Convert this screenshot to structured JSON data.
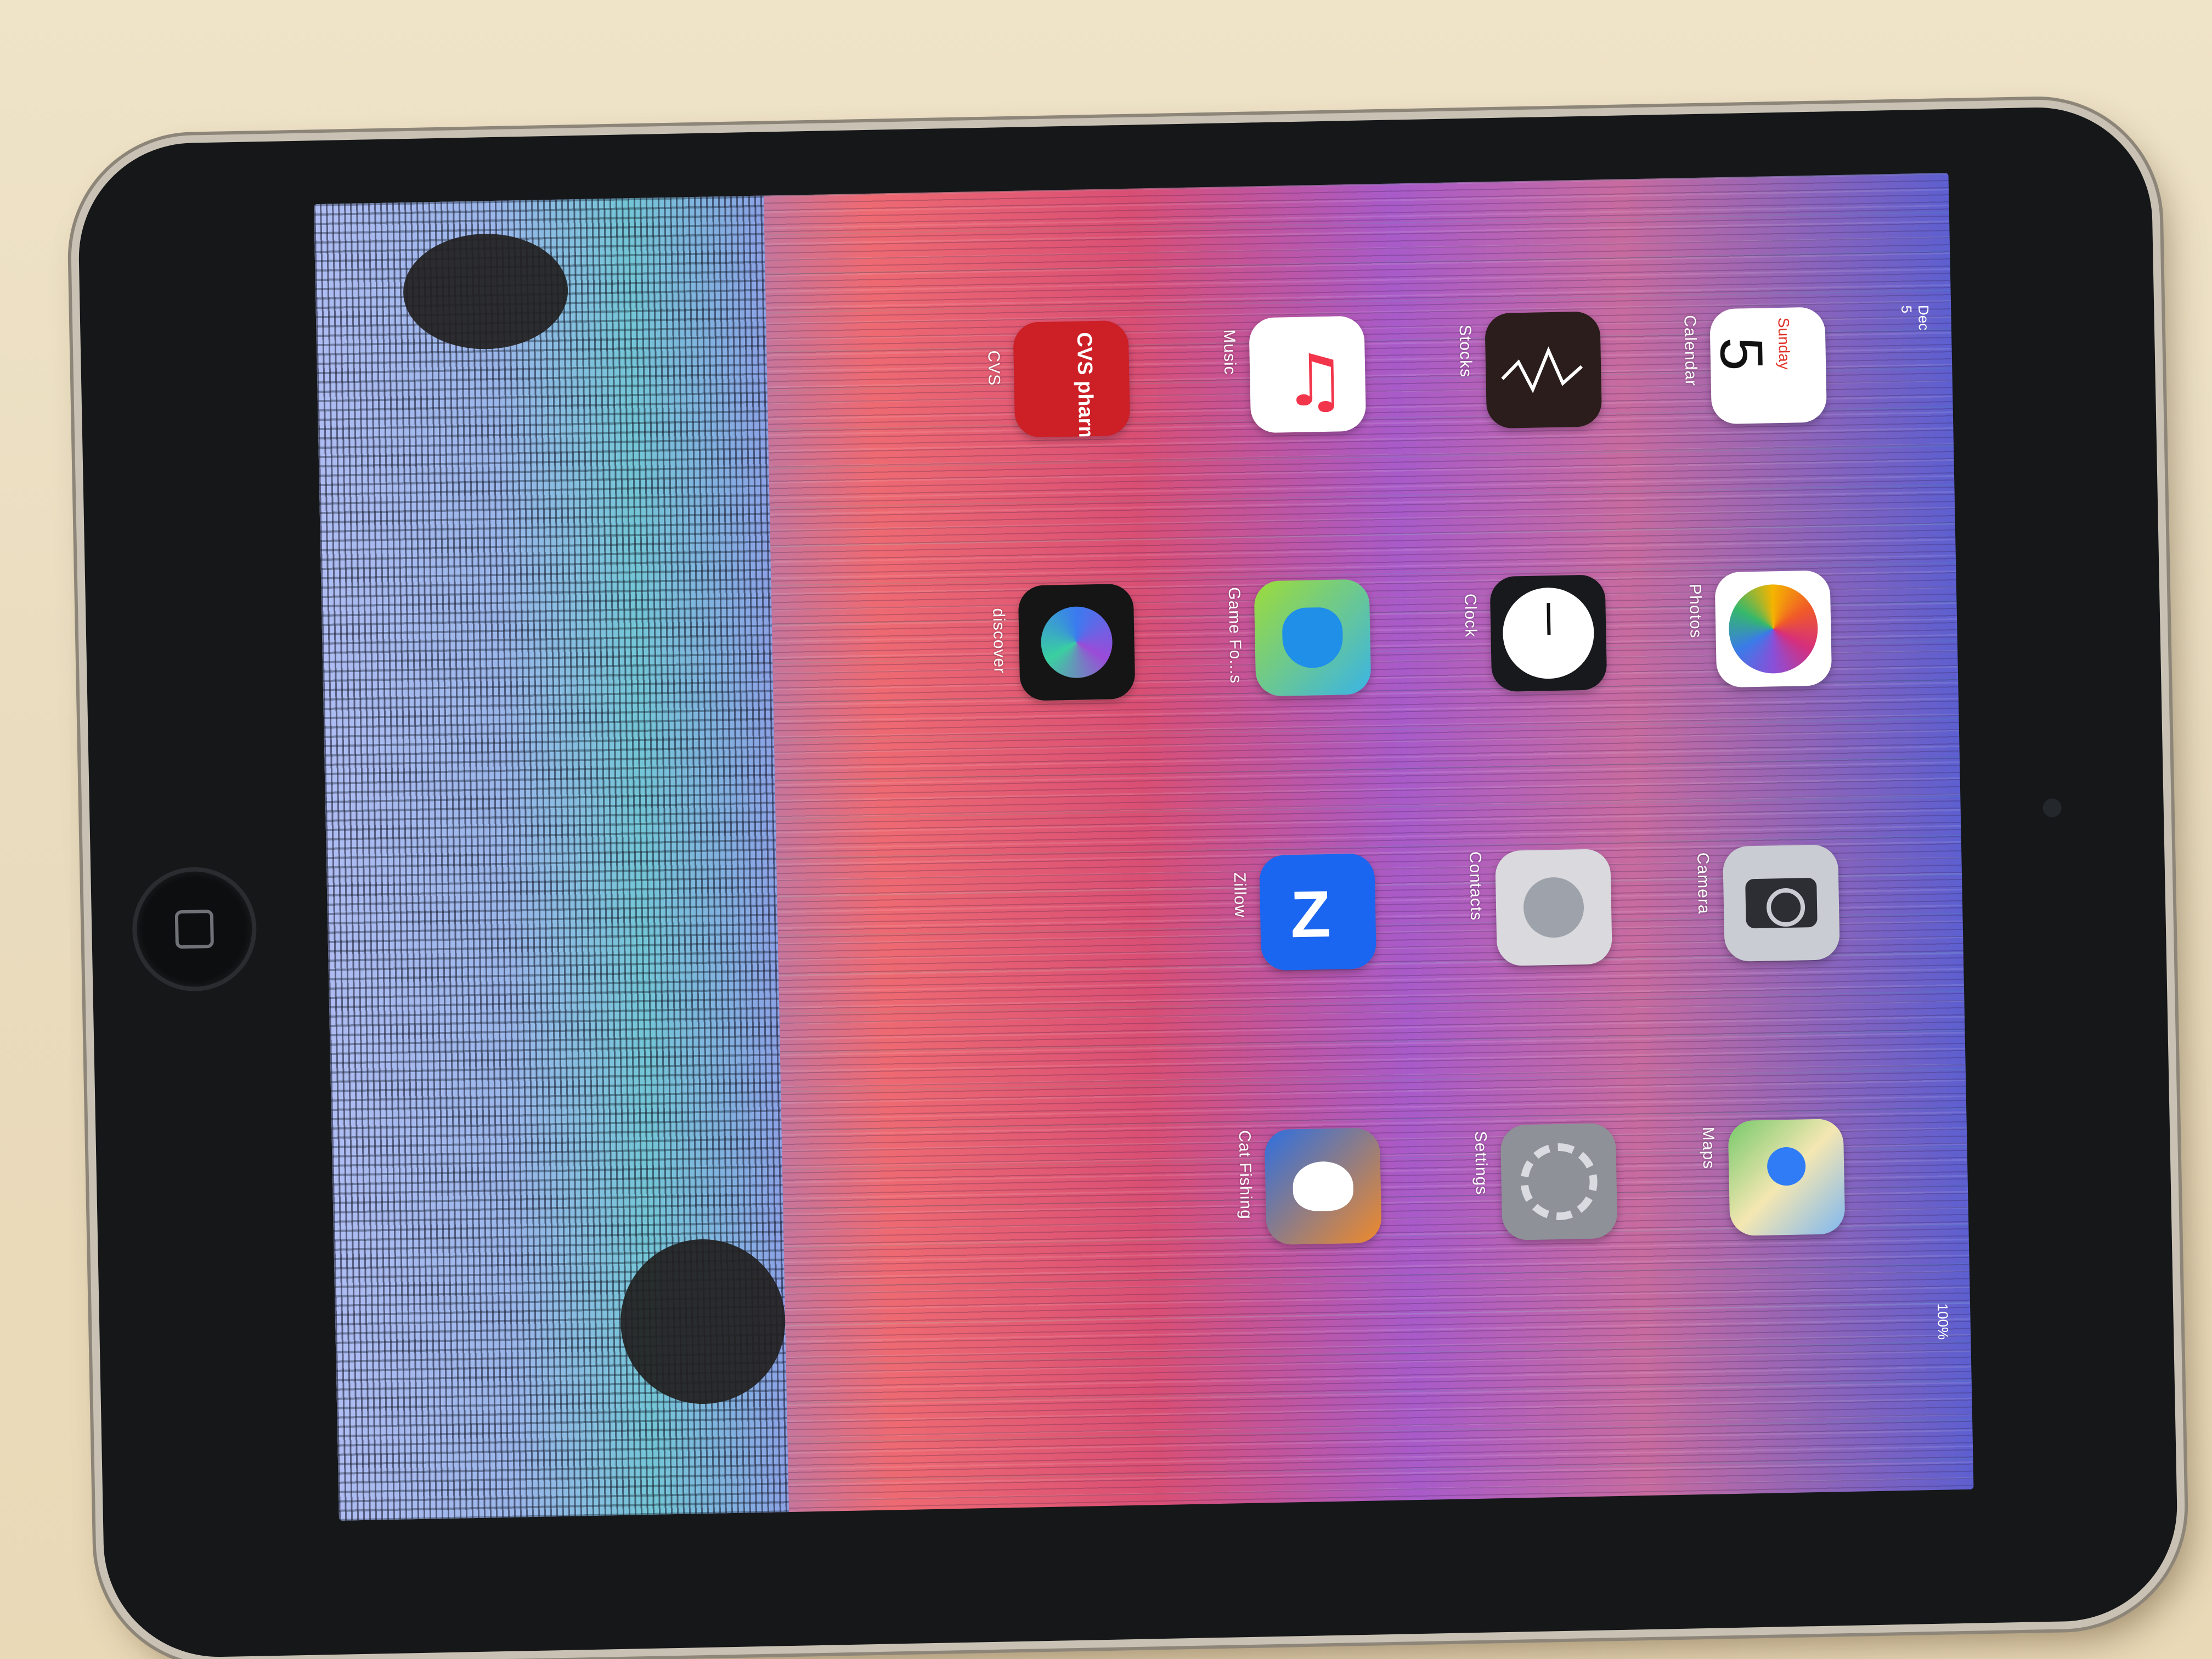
{
  "statusbar": {
    "date": "Dec 5",
    "battery": "100%"
  },
  "calendar_widget": {
    "weekday": "Sunday",
    "day": "5"
  },
  "apps": [
    {
      "label": "Calendar",
      "icon": "calendar-icon"
    },
    {
      "label": "Stocks",
      "icon": "stocks-icon"
    },
    {
      "label": "Music",
      "icon": "music-icon"
    },
    {
      "label": "CVS",
      "icon": "cvs-pharmacy-icon",
      "icon_text": "CVS pharmacy"
    },
    {
      "label": "Photos",
      "icon": "photos-icon"
    },
    {
      "label": "Clock",
      "icon": "clock-icon"
    },
    {
      "label": "Game Fo...s",
      "icon": "game-icon"
    },
    {
      "label": "discover",
      "icon": "discovery-icon"
    },
    {
      "label": "Camera",
      "icon": "camera-icon"
    },
    {
      "label": "Contacts",
      "icon": "contacts-icon"
    },
    {
      "label": "Zillow",
      "icon": "zillow-icon"
    },
    {
      "label": "Maps",
      "icon": "maps-icon"
    },
    {
      "label": "Settings",
      "icon": "settings-icon"
    },
    {
      "label": "Cat Fishing",
      "icon": "cat-fishing-icon"
    }
  ],
  "colors": {
    "bezel": "#151719",
    "wallpaper_red": "#e8606c",
    "wallpaper_purple": "#9b6ad6"
  }
}
